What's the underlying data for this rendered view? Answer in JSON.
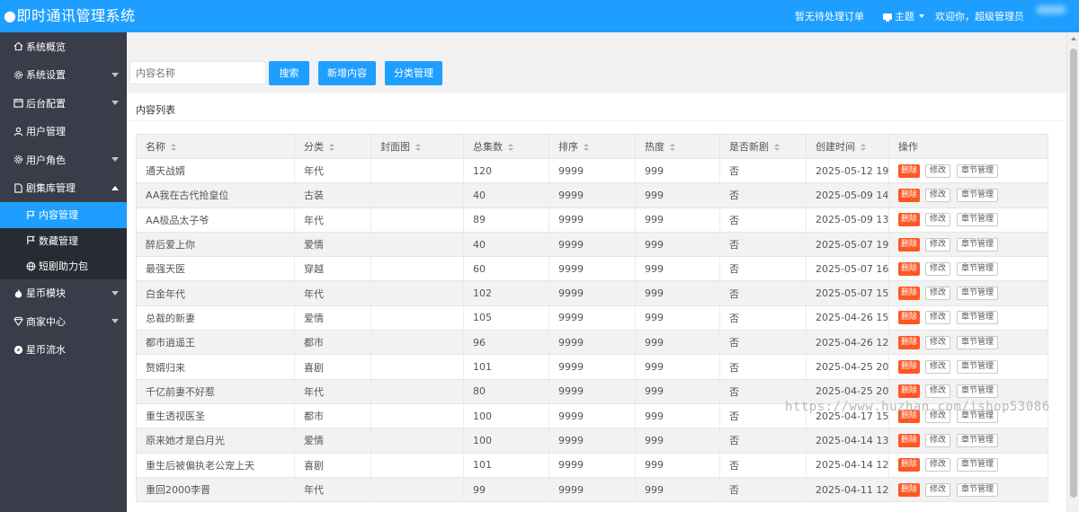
{
  "header": {
    "title": "●即时通讯管理系统",
    "orders_text": "暂无待处理订单",
    "theme_label": "主题",
    "welcome": "欢迎你，超级管理员"
  },
  "sidebar": {
    "items": [
      {
        "label": "系统概览",
        "icon": "home-icon"
      },
      {
        "label": "系统设置",
        "icon": "gear-icon"
      },
      {
        "label": "后台配置",
        "icon": "calendar-icon"
      },
      {
        "label": "用户管理",
        "icon": "user-icon"
      },
      {
        "label": "用户角色",
        "icon": "gear-icon"
      },
      {
        "label": "剧集库管理",
        "icon": "file-icon"
      },
      {
        "label": "星币模块",
        "icon": "fire-icon"
      },
      {
        "label": "商家中心",
        "icon": "diamond-icon"
      },
      {
        "label": "星币流水",
        "icon": "compass-icon"
      }
    ],
    "sub_items": [
      {
        "label": "内容管理",
        "icon": "flag-icon"
      },
      {
        "label": "数藏管理",
        "icon": "flag-icon"
      },
      {
        "label": "短剧助力包",
        "icon": "globe-icon"
      }
    ]
  },
  "toolbar": {
    "search_placeholder": "内容名称",
    "search_button": "搜索",
    "add_button": "新增内容",
    "category_button": "分类管理"
  },
  "card": {
    "title": "内容列表"
  },
  "table": {
    "headers": [
      "名称",
      "分类",
      "封面图",
      "总集数",
      "排序",
      "热度",
      "是否新剧",
      "创建时间",
      "操作"
    ],
    "actions": {
      "delete": "删除",
      "edit": "修改",
      "chapters": "章节管理"
    },
    "rows": [
      [
        "通天战婿",
        "年代",
        "",
        "120",
        "9999",
        "999",
        "否",
        "2025-05-12 19:31:"
      ],
      [
        "AA我在古代抢皇位",
        "古装",
        "",
        "40",
        "9999",
        "999",
        "否",
        "2025-05-09 14:20:"
      ],
      [
        "AA极品太子爷",
        "年代",
        "",
        "89",
        "9999",
        "999",
        "否",
        "2025-05-09 13:45:"
      ],
      [
        "醉后爱上你",
        "爱情",
        "",
        "40",
        "9999",
        "999",
        "否",
        "2025-05-07 19:38:"
      ],
      [
        "最强天医",
        "穿越",
        "",
        "60",
        "9999",
        "999",
        "否",
        "2025-05-07 16:00:"
      ],
      [
        "白金年代",
        "年代",
        "",
        "102",
        "9999",
        "999",
        "否",
        "2025-05-07 15:30:"
      ],
      [
        "总裁的新妻",
        "爱情",
        "",
        "105",
        "9999",
        "999",
        "否",
        "2025-04-26 15:35:"
      ],
      [
        "都市逍遥王",
        "都市",
        "",
        "96",
        "9999",
        "999",
        "否",
        "2025-04-26 12:55:"
      ],
      [
        "赘婿归来",
        "喜剧",
        "",
        "101",
        "9999",
        "999",
        "否",
        "2025-04-25 20:46:"
      ],
      [
        "千亿前妻不好惹",
        "年代",
        "",
        "80",
        "9999",
        "999",
        "否",
        "2025-04-25 20:22:"
      ],
      [
        "重生透视医圣",
        "都市",
        "",
        "100",
        "9999",
        "999",
        "否",
        "2025-04-17 15:10:"
      ],
      [
        "原来她才是白月光",
        "爱情",
        "",
        "100",
        "9999",
        "999",
        "否",
        "2025-04-14 13:07:"
      ],
      [
        "重生后被偏执老公宠上天",
        "喜剧",
        "",
        "101",
        "9999",
        "999",
        "否",
        "2025-04-14 12:22:"
      ],
      [
        "重回2000李晋",
        "年代",
        "",
        "99",
        "9999",
        "999",
        "否",
        "2025-04-11 12:12:"
      ]
    ]
  },
  "watermark": "https://www.huzhan.com/ishop53086",
  "colors": {
    "primary": "#1e9fff",
    "sidebar": "#393d49",
    "danger": "#ff5722"
  }
}
